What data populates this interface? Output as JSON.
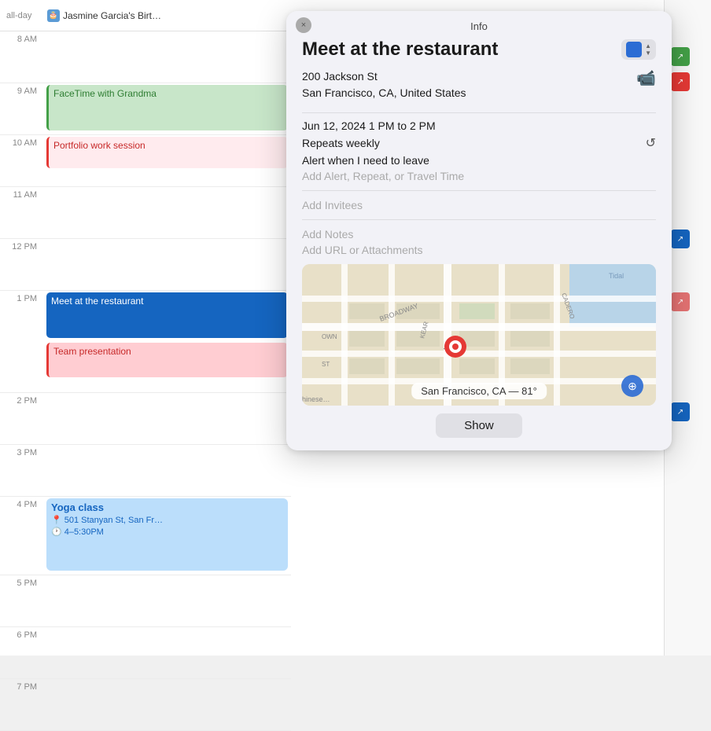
{
  "calendar": {
    "allday_label": "all-day",
    "allday_event": "Jasmine Garcia's Birt…",
    "times": [
      "8 AM",
      "9 AM",
      "10 AM",
      "11 AM",
      "12 PM",
      "1 PM",
      "2 PM",
      "3 PM",
      "4 PM",
      "5 PM",
      "6 PM",
      "7 PM"
    ],
    "events": {
      "facetime": "FaceTime with Grandma",
      "portfolio": "Portfolio work session",
      "restaurant": "Meet at the restaurant",
      "team": "Team presentation",
      "yoga": "Yoga class",
      "yoga_address": "501 Stanyan St, San Fr…",
      "yoga_time": "4–5:30PM"
    }
  },
  "popup": {
    "close_label": "×",
    "header_title": "Info",
    "event_title": "Meet at the restaurant",
    "address_line1": "200 Jackson St",
    "address_line2": "San Francisco, CA, United States",
    "date_time": "Jun 12, 2024  1 PM to 2 PM",
    "repeats": "Repeats weekly",
    "alert": "Alert when I need to leave",
    "add_alert": "Add Alert, Repeat, or Travel Time",
    "add_invitees": "Add Invitees",
    "add_notes": "Add Notes",
    "add_url": "Add URL or Attachments",
    "map_label": "San Francisco, CA — 81°",
    "show_button": "Show",
    "color_swatch": "#2b6cd4"
  }
}
